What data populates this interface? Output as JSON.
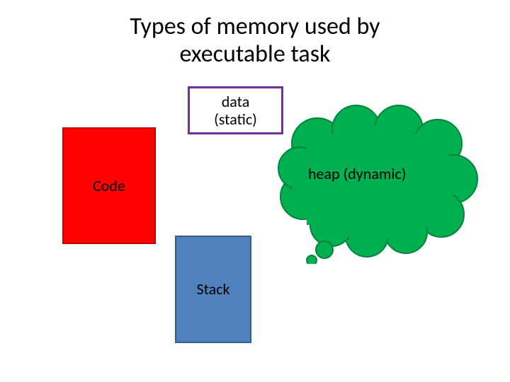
{
  "title_line1": "Types of memory used by",
  "title_line2": "executable task",
  "boxes": {
    "data_line1": "data",
    "data_line2": "(static)",
    "code": "Code",
    "stack": "Stack",
    "heap": "heap (dynamic)"
  },
  "colors": {
    "code_fill": "#ff0000",
    "data_border": "#7030a0",
    "stack_fill": "#4f81bd",
    "heap_fill": "#00b050"
  }
}
